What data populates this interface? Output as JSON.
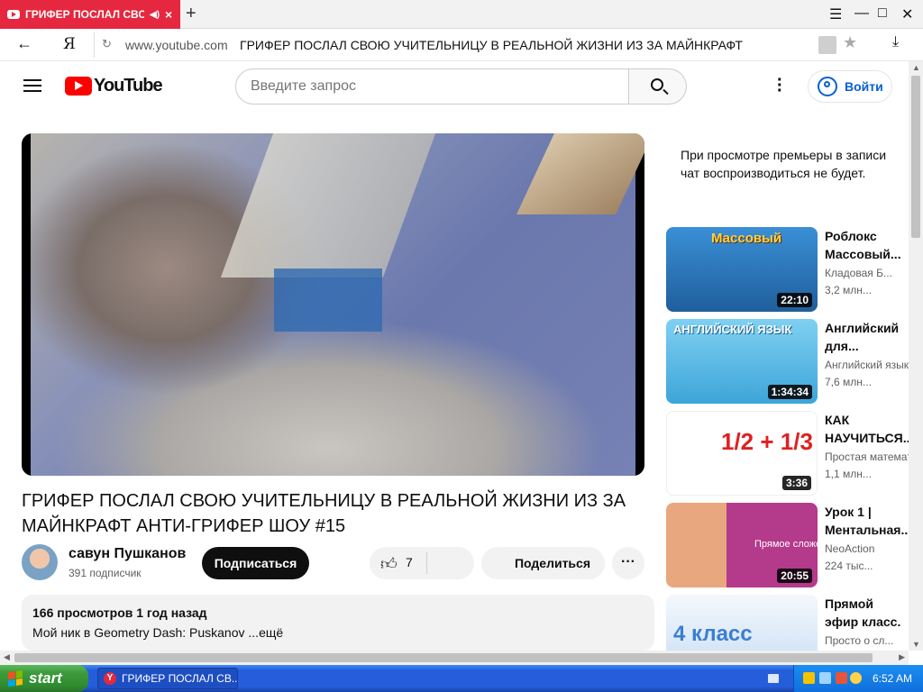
{
  "browser": {
    "tab_title": "ГРИФЕР ПОСЛАЛ СВОЮ",
    "new_tab": "+",
    "address_domain": "www.youtube.com",
    "address_title": "ГРИФЕР ПОСЛАЛ СВОЮ УЧИТЕЛЬНИЦУ В РЕАЛЬНОЙ ЖИЗНИ ИЗ ЗА МАЙНКРАФТ АН...",
    "yandex_letter": "Я"
  },
  "header": {
    "logo_text": "YouTube",
    "search_placeholder": "Введите запрос",
    "signin_label": "Войти"
  },
  "video": {
    "title": "ГРИФЕР ПОСЛАЛ СВОЮ УЧИТЕЛЬНИЦУ В РЕАЛЬНОЙ ЖИЗНИ ИЗ ЗА МАЙНКРАФТ АНТИ-ГРИФЕР ШОУ #15",
    "channel_name": "савун Пушканов",
    "subscribers": "391 подписчик",
    "subscribe_label": "Подписаться",
    "likes": "7",
    "share_label": "Поделиться",
    "description_meta": "166 просмотров  1 год назад",
    "description_text": "Мой ник в Geometry Dash: Puskanov ...ещё"
  },
  "sidebar": {
    "premiere_note": "При просмотре премьеры в записи чат воспроизводиться не будет.",
    "recommendations": [
      {
        "title": "Роблокс Массовый...",
        "channel": "Кладовая Б...",
        "views": "3,2 млн...",
        "duration": "22:10",
        "thumb_text": "Массовый",
        "thumb_color": "#2e7fc4"
      },
      {
        "title": "Английский для...",
        "channel": "Английский язык",
        "views": "7,6 млн...",
        "duration": "1:34:34",
        "thumb_text": "АНГЛИЙСКИЙ ЯЗЫК",
        "thumb_color": "#4bb6e6"
      },
      {
        "title": "КАК НАУЧИТЬСЯ...",
        "channel": "Простая математика",
        "views": "1,1 млн...",
        "duration": "3:36",
        "thumb_text": "1/2 + 1/3",
        "thumb_color": "#ffffff"
      },
      {
        "title": "Урок 1 | Ментальная...",
        "channel": "NeoAction",
        "views": "224 тыс...",
        "duration": "20:55",
        "thumb_text": "Прямое сложение",
        "thumb_color": "#b43a8c"
      },
      {
        "title": "Прямой эфир класс. Мой...",
        "channel": "Просто о сл...",
        "views": "",
        "duration": "",
        "thumb_text": "4 класс",
        "thumb_color": "#d9e7f7"
      }
    ]
  },
  "taskbar": {
    "start_label": "start",
    "task_label": "ГРИФЕР ПОСЛАЛ СВ...",
    "clock": "6:52 AM"
  }
}
